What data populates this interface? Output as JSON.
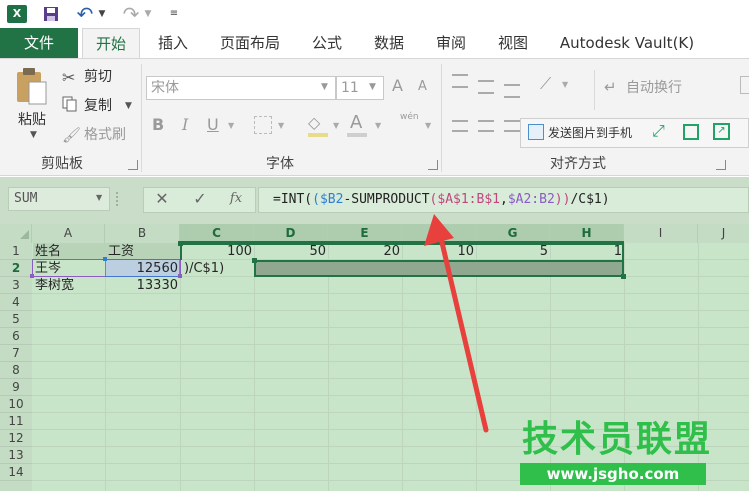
{
  "quick_access": {
    "undo_icon": "↶",
    "redo_icon": "↷"
  },
  "tabs": {
    "file": "文件",
    "items": [
      "开始",
      "插入",
      "页面布局",
      "公式",
      "数据",
      "审阅",
      "视图",
      "Autodesk Vault(K)"
    ]
  },
  "ribbon": {
    "clipboard": {
      "paste": "粘贴",
      "cut": "剪切",
      "copy": "复制",
      "format_painter": "格式刷",
      "group_label": "剪贴板"
    },
    "font": {
      "font_name": "宋体",
      "font_size": "11",
      "bold": "B",
      "italic": "I",
      "underline": "U",
      "wen": "wén",
      "group_label": "字体",
      "grow": "A",
      "shrink": "A",
      "font_color": "A"
    },
    "alignment": {
      "wrap_text": "自动换行",
      "group_label": "对齐方式"
    },
    "popup": {
      "send_image": "发送图片到手机"
    }
  },
  "formula_bar": {
    "name_box": "SUM",
    "fx": "fx",
    "cancel": "✕",
    "enter": "✓",
    "formula_parts": [
      {
        "text": "=INT(",
        "color": "#222222"
      },
      {
        "text": "(",
        "color": "#2f7fd0"
      },
      {
        "text": "$B2",
        "color": "#2f7fd0"
      },
      {
        "text": "-SUMPRODUCT",
        "color": "#222222"
      },
      {
        "text": "(",
        "color": "#c1467e"
      },
      {
        "text": "$A$1:B$1",
        "color": "#c1467e"
      },
      {
        "text": ",",
        "color": "#222222"
      },
      {
        "text": "$A2:B2",
        "color": "#8a5cc4"
      },
      {
        "text": "))",
        "color": "#c1467e"
      },
      {
        "text": "/C$1)",
        "color": "#222222"
      }
    ]
  },
  "grid": {
    "columns": [
      "A",
      "B",
      "C",
      "D",
      "E",
      "F",
      "G",
      "H",
      "I",
      "J"
    ],
    "rows": [
      "1",
      "2",
      "3",
      "4",
      "5",
      "6",
      "7",
      "8",
      "9",
      "10",
      "11",
      "12",
      "13",
      "14"
    ],
    "cells": {
      "A1": "姓名",
      "B1": "工资",
      "C1": "100",
      "D1": "50",
      "E1": "20",
      "F1": "10",
      "G1": "5",
      "H1": "1",
      "A2": "王岑",
      "B2": "12560",
      "C2": ")/C$1)",
      "A3": "李树宽",
      "B3": "13330"
    }
  },
  "watermark": {
    "title": "技术员联盟",
    "url": "www.jsgho.com"
  },
  "colors": {
    "accent": "#217346",
    "arrow": "#e8413d"
  }
}
